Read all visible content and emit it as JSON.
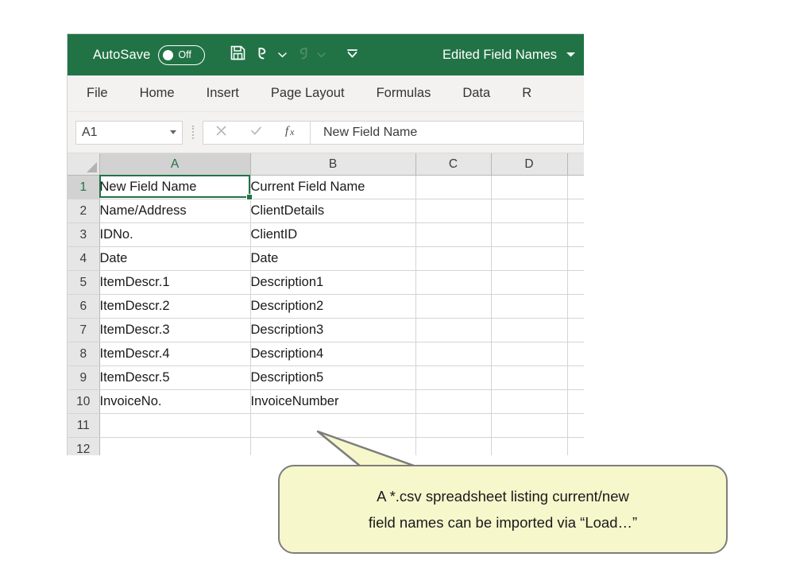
{
  "window": {
    "title_bar": {
      "autosave_label": "AutoSave",
      "autosave_state": "Off",
      "quick_access": [
        {
          "name": "save-icon",
          "label": "Save"
        },
        {
          "name": "undo-icon",
          "label": "Undo"
        },
        {
          "name": "undo-dropdown-icon",
          "label": "Undo options"
        },
        {
          "name": "redo-icon",
          "label": "Redo"
        },
        {
          "name": "redo-dropdown-icon",
          "label": "Redo options"
        },
        {
          "name": "customize-quick-access-toolbar-icon",
          "label": "Customize Quick Access Toolbar"
        }
      ],
      "document_title": "Edited Field Names",
      "title_dropdown_icon": "chevron-down-icon"
    },
    "ribbon_tabs": [
      {
        "label": "File"
      },
      {
        "label": "Home"
      },
      {
        "label": "Insert"
      },
      {
        "label": "Page Layout"
      },
      {
        "label": "Formulas"
      },
      {
        "label": "Data"
      },
      {
        "label": "R"
      }
    ],
    "formula_bar": {
      "name_box_value": "A1",
      "cancel_icon": "close-icon",
      "confirm_icon": "check-icon",
      "function_icon": "fx-icon",
      "formula_value": "New Field Name"
    },
    "grid": {
      "column_headers": [
        "A",
        "B",
        "C",
        "D"
      ],
      "selected_column": "A",
      "selected_row": "1",
      "active_cell": "A1",
      "row_numbers": [
        "1",
        "2",
        "3",
        "4",
        "5",
        "6",
        "7",
        "8",
        "9",
        "10",
        "11",
        "12"
      ],
      "rows": [
        {
          "num": "1",
          "a": "New Field Name",
          "b": "Current Field Name",
          "c": "",
          "d": ""
        },
        {
          "num": "2",
          "a": "Name/Address",
          "b": "ClientDetails",
          "c": "",
          "d": ""
        },
        {
          "num": "3",
          "a": "IDNo.",
          "b": "ClientID",
          "c": "",
          "d": ""
        },
        {
          "num": "4",
          "a": "Date",
          "b": "Date",
          "c": "",
          "d": ""
        },
        {
          "num": "5",
          "a": "ItemDescr.1",
          "b": "Description1",
          "c": "",
          "d": ""
        },
        {
          "num": "6",
          "a": "ItemDescr.2",
          "b": "Description2",
          "c": "",
          "d": ""
        },
        {
          "num": "7",
          "a": "ItemDescr.3",
          "b": "Description3",
          "c": "",
          "d": ""
        },
        {
          "num": "8",
          "a": "ItemDescr.4",
          "b": "Description4",
          "c": "",
          "d": ""
        },
        {
          "num": "9",
          "a": "ItemDescr.5",
          "b": "Description5",
          "c": "",
          "d": ""
        },
        {
          "num": "10",
          "a": "InvoiceNo.",
          "b": "InvoiceNumber",
          "c": "",
          "d": ""
        },
        {
          "num": "11",
          "a": "",
          "b": "",
          "c": "",
          "d": ""
        },
        {
          "num": "12",
          "a": "",
          "b": "",
          "c": "",
          "d": ""
        }
      ]
    }
  },
  "callout": {
    "line1": "A *.csv spreadsheet listing current/new",
    "line2": "field names can be imported via “Load…”"
  },
  "colors": {
    "excel_green": "#217346",
    "ribbon_bg": "#f3f2f1",
    "header_gray": "#e6e6e6",
    "header_selected_gray": "#d2d2d2",
    "callout_fill": "#f7f7cc",
    "callout_border": "#7d7d7d"
  }
}
